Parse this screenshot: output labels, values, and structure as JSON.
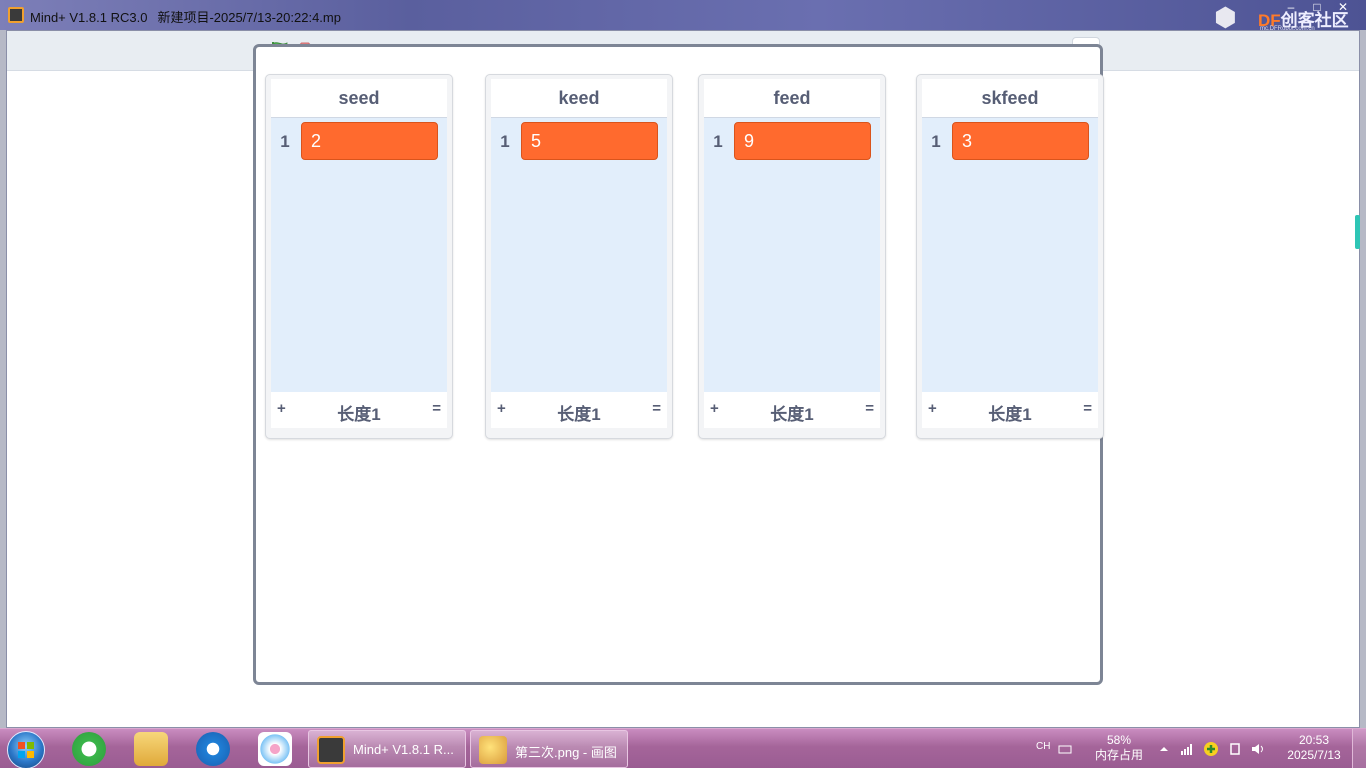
{
  "window": {
    "app_name": "Mind+ V1.8.1 RC3.0",
    "project_name": "新建项目-2025/7/13-20:22:4.mp",
    "logo_brand_prefix": "DF",
    "logo_brand": "创客社区",
    "logo_sub": "mc.DFRobot.com.cn"
  },
  "toolbar": {
    "green_flag_icon": "green-flag",
    "stop_icon": "stop-octagon",
    "accent_colors": {
      "flag": "#4cae4c",
      "stop": "#e8888a",
      "list_item": "#ff6a2e"
    }
  },
  "lists": [
    {
      "name": "seed",
      "items": [
        {
          "index": "1",
          "value": "2"
        }
      ],
      "add": "+",
      "length_label": "长度1",
      "resize": "="
    },
    {
      "name": "keed",
      "items": [
        {
          "index": "1",
          "value": "5"
        }
      ],
      "add": "+",
      "length_label": "长度1",
      "resize": "="
    },
    {
      "name": "feed",
      "items": [
        {
          "index": "1",
          "value": "9"
        }
      ],
      "add": "+",
      "length_label": "长度1",
      "resize": "="
    },
    {
      "name": "skfeed",
      "items": [
        {
          "index": "1",
          "value": "3"
        }
      ],
      "add": "+",
      "length_label": "长度1",
      "resize": "="
    }
  ],
  "taskbar": {
    "tasks": [
      {
        "label": "Mind+ V1.8.1 R...",
        "icon": "mindplus-icon"
      },
      {
        "label": "第三次.png - 画图",
        "icon": "paint-icon"
      }
    ],
    "quick_launch": [
      "ie-icon",
      "explorer-icon",
      "sogou-icon",
      "baidu-netdisk-icon"
    ],
    "language": "CH",
    "memory_percent": "58%",
    "memory_label": "内存占用",
    "time": "20:53",
    "date": "2025/7/13"
  }
}
